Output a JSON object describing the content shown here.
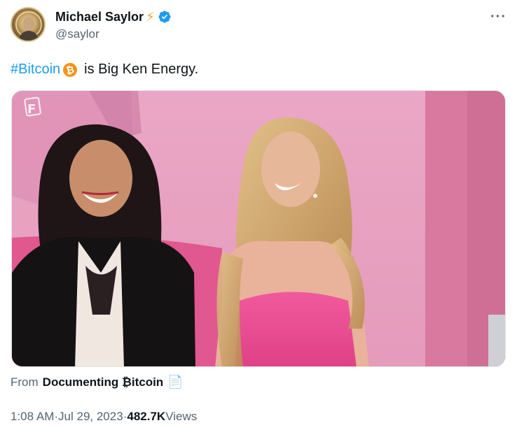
{
  "author": {
    "display_name": "Michael Saylor",
    "handle": "@saylor",
    "name_emoji": "lightning-bolt",
    "verified": true
  },
  "tweet": {
    "hashtag": "#Bitcoin",
    "hashtag_emoji": "bitcoin-icon",
    "text": "is Big Ken Energy."
  },
  "media": {
    "watermark": "F"
  },
  "source": {
    "from_label": "From",
    "name": "Documenting ₿itcoin",
    "emoji": "page-facing-up"
  },
  "meta": {
    "time": "1:08 AM",
    "separator": " · ",
    "date": "Jul 29, 2023",
    "views_count": "482.7K",
    "views_label": " Views"
  },
  "colors": {
    "accent": "#1d9bf0",
    "bitcoin": "#f7931a",
    "muted": "#536471",
    "text": "#0f1419"
  }
}
